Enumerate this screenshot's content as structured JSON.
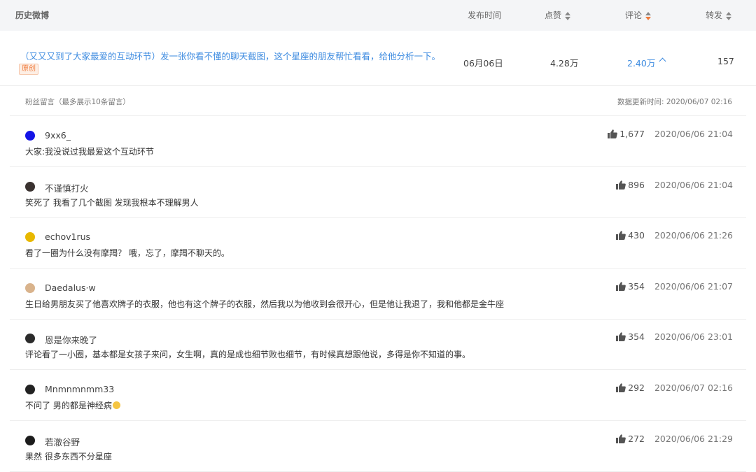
{
  "header": {
    "title": "历史微博",
    "time": "发布时间",
    "likes": "点赞",
    "comments": "评论",
    "reposts": "转发"
  },
  "post": {
    "text": "（又又又到了大家最爱的互动环节）发一张你看不懂的聊天截图，这个星座的朋友帮忙看看，给他分析一下。",
    "badge": "原创",
    "date": "06月06日",
    "likes": "4.28万",
    "comments": "2.40万",
    "reposts": "157"
  },
  "panel": {
    "title": "粉丝留言（最多展示10条留言）",
    "updated": "数据更新时间: 2020/06/07 02:16"
  },
  "comments": [
    {
      "user": "9xx6_",
      "text": "大家:我没说过我最爱这个互动环节",
      "likes": "1,677",
      "time": "2020/06/06 21:04",
      "avatar_color": "#1414e6"
    },
    {
      "user": "不谨慎打火",
      "text": "笑死了 我看了几个截图 发现我根本不理解男人",
      "likes": "896",
      "time": "2020/06/06 21:04",
      "avatar_color": "#3a3230"
    },
    {
      "user": "echov1rus",
      "text": "看了一圈为什么没有摩羯？ 哦，忘了，摩羯不聊天的。",
      "likes": "430",
      "time": "2020/06/06 21:26",
      "avatar_color": "#e8b800"
    },
    {
      "user": "Daedalus·w",
      "text": "生日给男朋友买了他喜欢牌子的衣服，他也有这个牌子的衣服，然后我以为他收到会很开心，但是他让我退了，我和他都是金牛座",
      "likes": "354",
      "time": "2020/06/06 21:07",
      "avatar_color": "#d9b38c"
    },
    {
      "user": "恩是你来晚了",
      "text": "评论看了一小圈，基本都是女孩子来问，女生啊，真的是成也细节败也细节，有时候真想跟他说，多得是你不知道的事。",
      "likes": "354",
      "time": "2020/06/06 23:01",
      "avatar_color": "#2b2b2b"
    },
    {
      "user": "Mnmnmnmm33",
      "text": "不问了 男的都是神经病",
      "likes": "292",
      "time": "2020/06/07 02:16",
      "avatar_color": "#222222"
    },
    {
      "user": "若澈谷野",
      "text": "果然 很多东西不分星座",
      "likes": "272",
      "time": "2020/06/06 21:29",
      "avatar_color": "#1c1c1c"
    }
  ],
  "colors": {
    "link": "#3d8be0",
    "accent": "#f07a3a",
    "header_bg": "#f4f5f7"
  },
  "icons": [
    "thumbs-up-icon",
    "sort-icon",
    "chevron-up-icon",
    "emoji-icon"
  ]
}
